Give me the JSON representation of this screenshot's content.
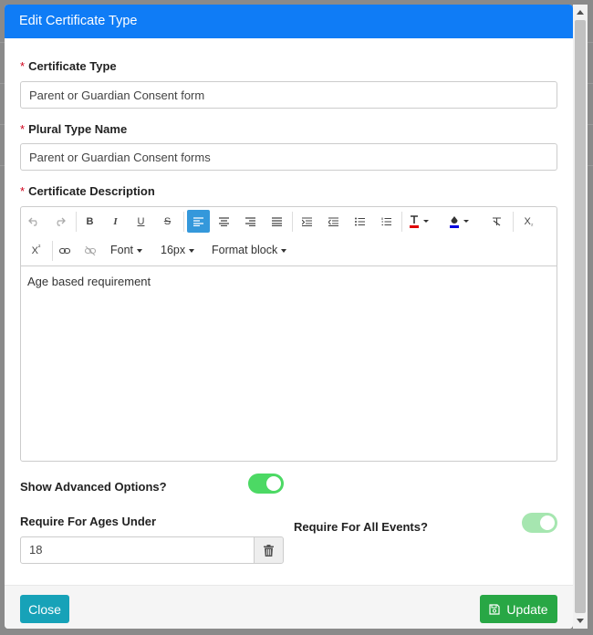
{
  "modal": {
    "title": "Edit Certificate Type"
  },
  "form": {
    "required_marker": "*",
    "certificate_type": {
      "label": "Certificate Type",
      "value": "Parent or Guardian Consent form"
    },
    "plural_type_name": {
      "label": "Plural Type Name",
      "value": "Parent or Guardian Consent forms"
    },
    "certificate_description": {
      "label": "Certificate Description",
      "content": "Age based requirement"
    },
    "advanced_options": {
      "label": "Show Advanced Options?",
      "enabled": true
    },
    "require_ages_under": {
      "label": "Require For Ages Under",
      "value": "18"
    },
    "require_all_events": {
      "label": "Require For All Events?",
      "enabled": true
    }
  },
  "editor_toolbar": {
    "font_label": "Font",
    "size_label": "16px",
    "format_label": "Format block",
    "text_color": "#e00000",
    "highlight_color": "#0000e0",
    "active_alignment": "align-left"
  },
  "footer": {
    "close_label": "Close",
    "update_label": "Update"
  },
  "colors": {
    "header": "#0f7cf6",
    "toggle_on": "#4cd964",
    "close_button": "#17a2b8",
    "update_button": "#28a745"
  }
}
